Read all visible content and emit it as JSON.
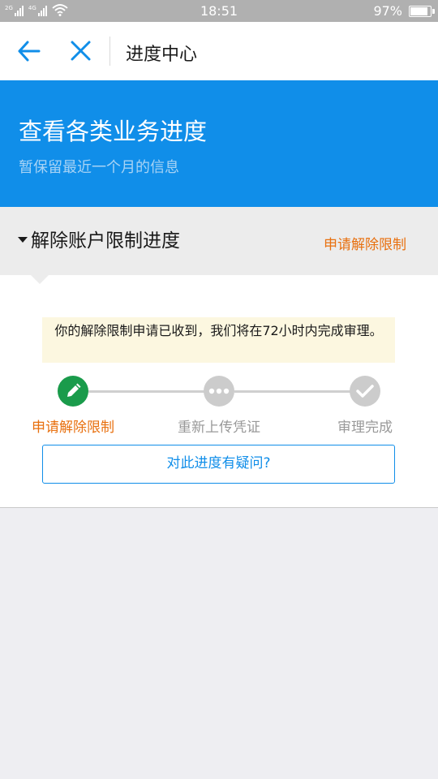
{
  "status_bar": {
    "network1": "2G",
    "network2": "4G",
    "time": "18:51",
    "battery_text": "97%",
    "battery_level": 0.97
  },
  "nav": {
    "back_icon": "arrow-left-icon",
    "close_icon": "close-icon",
    "title": "进度中心"
  },
  "banner": {
    "title": "查看各类业务进度",
    "subtitle": "暂保留最近一个月的信息"
  },
  "section": {
    "title": "解除账户限制进度",
    "action": "申请解除限制"
  },
  "progress": {
    "notice": "你的解除限制申请已收到，我们将在72小时内完成审理。",
    "steps": [
      {
        "label": "申请解除限制",
        "icon": "pencil-icon",
        "state": "active"
      },
      {
        "label": "重新上传凭证",
        "icon": "more-dots-icon",
        "state": "pending"
      },
      {
        "label": "审理完成",
        "icon": "check-icon",
        "state": "pending"
      }
    ],
    "question_button": "对此进度有疑问?"
  },
  "colors": {
    "primary_blue": "#108ee9",
    "active_green": "#1a9b4b",
    "pending_gray": "#cccccc",
    "accent_orange": "#e8700f",
    "notice_bg": "#fcf7e0"
  }
}
